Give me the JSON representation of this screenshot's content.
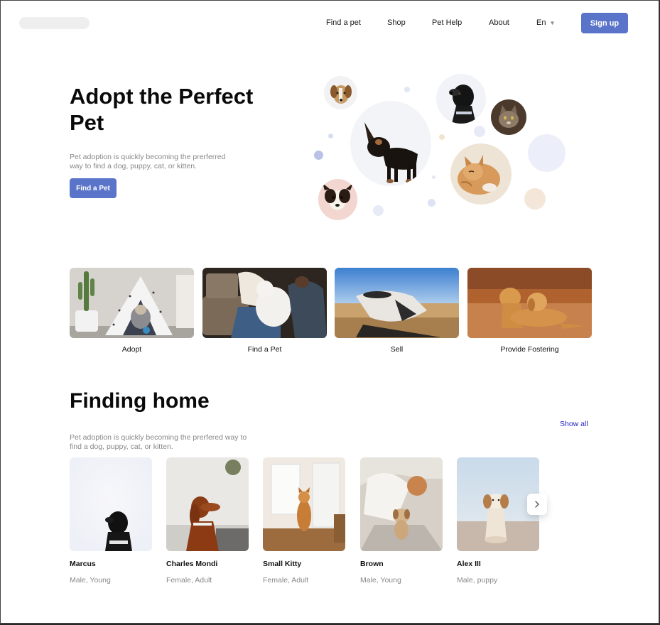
{
  "nav": {
    "links": [
      "Find a pet",
      "Shop",
      "Pet Help",
      "About"
    ],
    "language": "En",
    "signup_label": "Sign up"
  },
  "hero": {
    "title": "Adopt the Perfect Pet",
    "subtitle": "Pet adoption is quickly becoming the prerferred way to find a dog, puppy, cat, or kitten.",
    "cta_label": "Find a Pet"
  },
  "categories": [
    {
      "label": "Adopt"
    },
    {
      "label": "Find a Pet"
    },
    {
      "label": "Sell"
    },
    {
      "label": "Provide Fostering"
    }
  ],
  "finding_home": {
    "title": "Finding home",
    "subtitle": "Pet adoption is quickly becoming the prerfered way to find a dog, puppy, cat, or kitten.",
    "show_all_label": "Show all",
    "pets": [
      {
        "name": "Marcus",
        "meta": "Male, Young"
      },
      {
        "name": "Charles Mondi",
        "meta": "Female, Adult"
      },
      {
        "name": "Small Kitty",
        "meta": "Female, Adult"
      },
      {
        "name": "Brown",
        "meta": "Male, Young"
      },
      {
        "name": "Alex III",
        "meta": "Male, puppy"
      }
    ]
  },
  "colors": {
    "accent": "#5a74c9",
    "link": "#2323c8",
    "muted_text": "#888888"
  }
}
